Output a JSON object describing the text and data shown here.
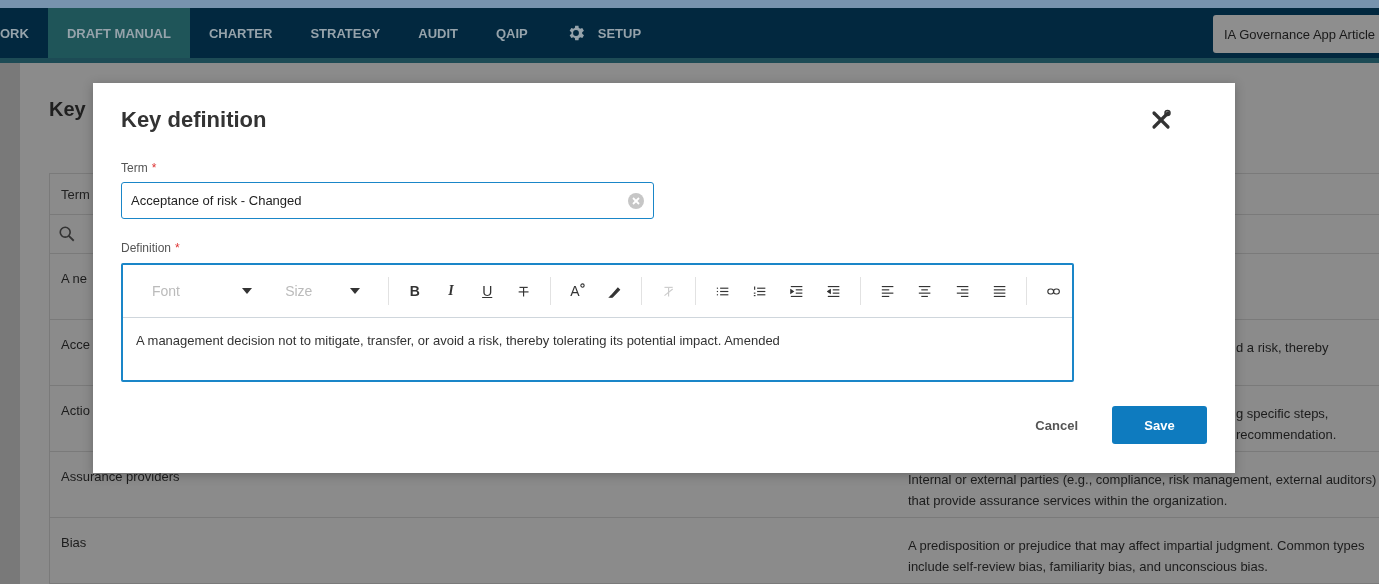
{
  "nav": {
    "tabs": [
      {
        "label": "ORK",
        "selected": false,
        "kind": "plain"
      },
      {
        "label": "DRAFT MANUAL",
        "selected": true,
        "kind": "plain"
      },
      {
        "label": "CHARTER",
        "selected": false,
        "kind": "plain"
      },
      {
        "label": "STRATEGY",
        "selected": false,
        "kind": "plain"
      },
      {
        "label": "AUDIT",
        "selected": false,
        "kind": "plain"
      },
      {
        "label": "QAIP",
        "selected": false,
        "kind": "plain"
      },
      {
        "label": "SETUP",
        "selected": false,
        "kind": "settings"
      }
    ],
    "app_button": "IA Governance App Article"
  },
  "page": {
    "title": "Key",
    "table": {
      "header": "Term",
      "rows": [
        {
          "term": "A ne"
        },
        {
          "term": "Acce",
          "definition": [
            "d a risk, thereby"
          ]
        },
        {
          "term": "Actio",
          "definition": [
            "g specific steps,",
            "recommendation."
          ]
        },
        {
          "term": "Assurance providers",
          "definition": [
            "Internal or external parties (e.g., compliance, risk management, external auditors)",
            "that provide assurance services within the organization."
          ]
        },
        {
          "term": "Bias",
          "definition": [
            "A predisposition or prejudice that may affect impartial judgment. Common types",
            "include self-review bias, familiarity bias, and unconscious bias."
          ]
        }
      ]
    }
  },
  "dialog": {
    "title": "Key definition",
    "term": {
      "label": "Term",
      "required_mark": "*",
      "value": "Acceptance of risk - Changed"
    },
    "definition": {
      "label": "Definition",
      "required_mark": "*",
      "font_placeholder": "Font",
      "size_placeholder": "Size",
      "toolbar": [
        [
          {
            "kind": "bold",
            "label": "B",
            "disabled": false
          },
          {
            "kind": "italic",
            "label": "I",
            "disabled": false
          },
          {
            "kind": "underline",
            "label": "U",
            "disabled": false
          },
          {
            "kind": "strikethrough",
            "disabled": false
          }
        ],
        [
          {
            "kind": "font-color",
            "label": "A",
            "disabled": false
          },
          {
            "kind": "highlight",
            "disabled": false
          }
        ],
        [
          {
            "kind": "clear-format",
            "disabled": true
          }
        ],
        [
          {
            "kind": "bullets",
            "disabled": false
          },
          {
            "kind": "numbers",
            "disabled": false
          },
          {
            "kind": "indent",
            "disabled": false
          },
          {
            "kind": "outdent",
            "disabled": false
          }
        ],
        [
          {
            "kind": "align-left",
            "disabled": false
          },
          {
            "kind": "align-center",
            "disabled": false
          },
          {
            "kind": "align-right",
            "disabled": false
          },
          {
            "kind": "justify",
            "disabled": false
          }
        ],
        [
          {
            "kind": "link",
            "disabled": false
          }
        ]
      ],
      "value": "A management decision not to mitigate, transfer, or avoid a risk, thereby tolerating its potential impact. Amended"
    },
    "buttons": [
      {
        "label": "Cancel",
        "kind": "secondary"
      },
      {
        "label": "Save",
        "kind": "primary"
      }
    ]
  }
}
